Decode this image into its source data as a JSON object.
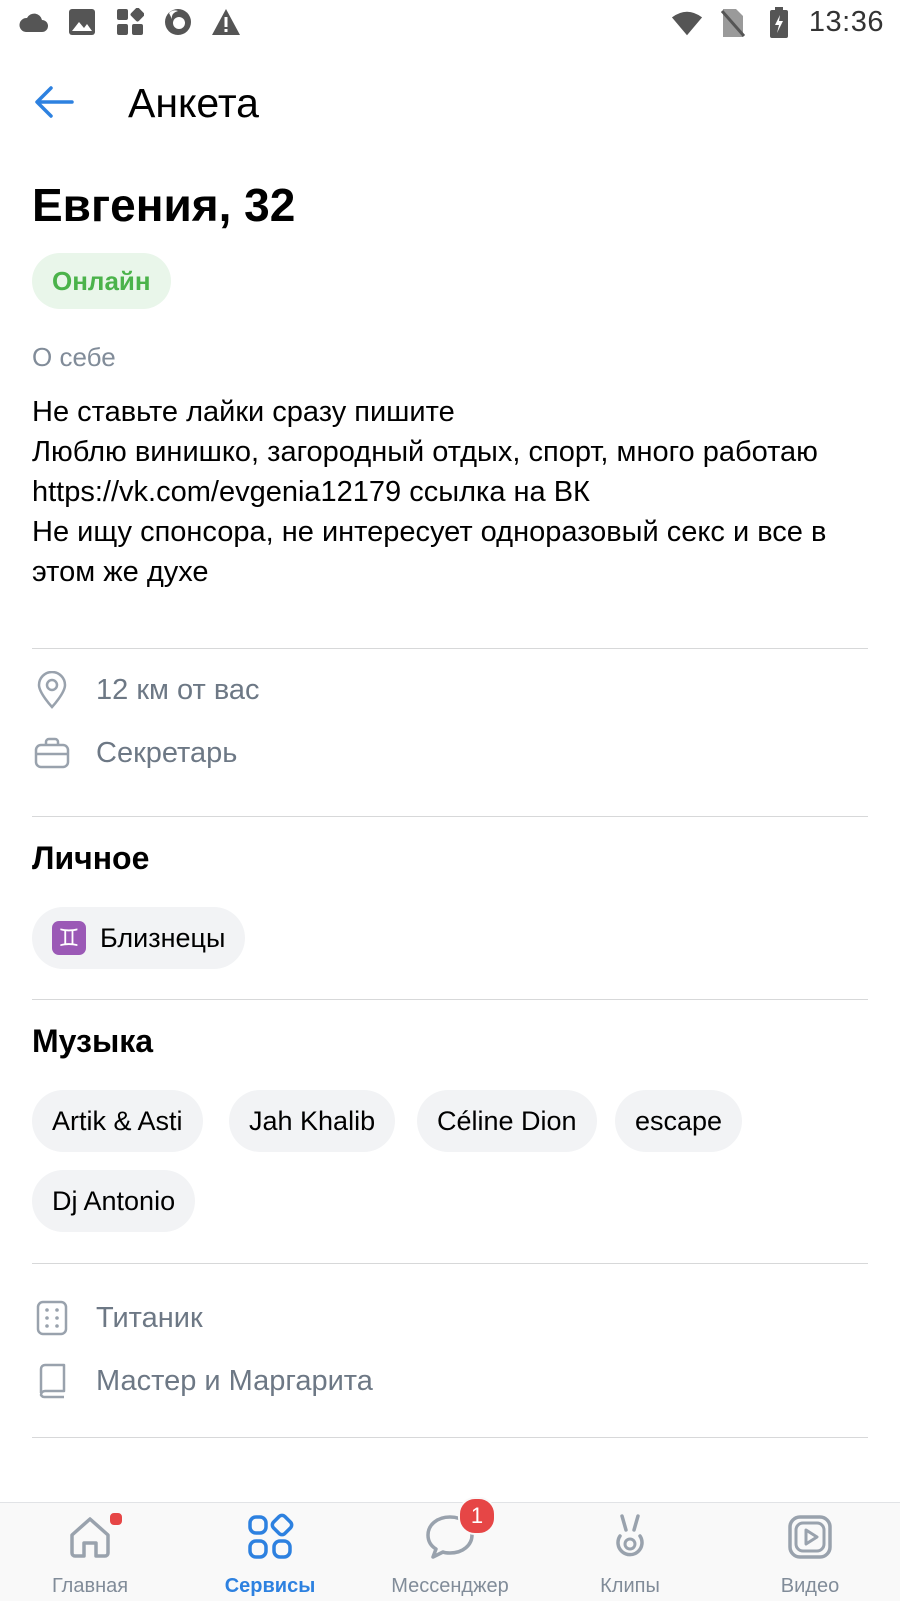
{
  "status_bar": {
    "time": "13:36",
    "left_icons": [
      "cloud-icon",
      "image-icon",
      "apps-icon",
      "firefox-icon",
      "warning-icon"
    ],
    "right_icons": [
      "wifi-icon",
      "no-sim-icon",
      "battery-icon"
    ]
  },
  "header": {
    "title": "Анкета"
  },
  "profile": {
    "name": "Евгения, 32",
    "status": "Онлайн",
    "about_label": "О себе",
    "about_text": "Не ставьте лайки сразу пишите\nЛюблю винишко, загородный отдых, спорт, много работаю\nhttps://vk.com/evgenia12179 ссылка на ВК\nНе ищу спонсора, не интересует одноразовый секс и все в этом же духе",
    "distance": "12 км от вас",
    "job": "Секретарь"
  },
  "personal": {
    "title": "Личное",
    "zodiac": "Близнецы",
    "zodiac_symbol": "♊"
  },
  "music": {
    "title": "Музыка",
    "artists": [
      "Artik & Asti",
      "Jah Khalib",
      "Céline Dion",
      "escape",
      "Dj Antonio"
    ]
  },
  "interests": {
    "movie": "Титаник",
    "book": "Мастер и Маргарита"
  },
  "tabbar": {
    "items": [
      {
        "label": "Главная",
        "icon": "home-icon"
      },
      {
        "label": "Сервисы",
        "icon": "services-icon"
      },
      {
        "label": "Мессенджер",
        "icon": "messenger-icon",
        "badge": "1"
      },
      {
        "label": "Клипы",
        "icon": "clips-icon"
      },
      {
        "label": "Видео",
        "icon": "video-icon"
      }
    ]
  },
  "colors": {
    "accent": "#2d81e0",
    "online_text": "#4bb34b",
    "online_bg": "#e9f6ea",
    "secondary_text": "#818c99",
    "badge": "#e64646"
  }
}
